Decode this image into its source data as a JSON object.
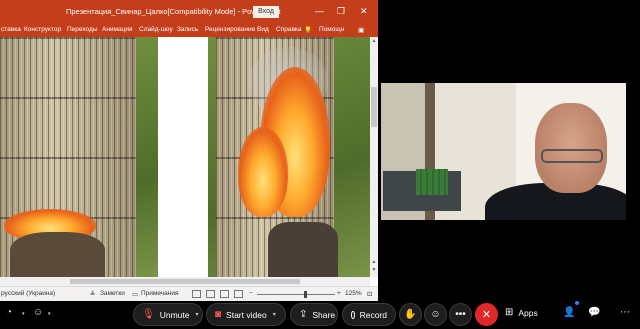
{
  "ppt": {
    "title": "Презентация_Свинар_Цалко[Compatibility Mode]  -  PowerPoint",
    "signin_label": "Вход",
    "win_minimize": "—",
    "win_restore": "❐",
    "win_close": "✕",
    "ribbon_tabs": [
      "ставка",
      "Конструктор",
      "Переходы",
      "Анимация",
      "Слайд-шоу",
      "Запись",
      "Рецензирование",
      "Вид",
      "Справка",
      "Помощн"
    ],
    "status": {
      "language": "русский (Украина)",
      "notes_label": "Заметки",
      "comments_label": "Примечания",
      "zoom_minus": "−",
      "zoom_plus": "+",
      "zoom_percent": "125%",
      "zoom_level": 0.62
    }
  },
  "participant": {
    "name": ""
  },
  "toolbar": {
    "unmute_label": "Unmute",
    "start_video_label": "Start video",
    "share_label": "Share",
    "record_label": "Record",
    "apps_label": "Apps",
    "leave_symbol": "✕",
    "more_symbol": "•••"
  },
  "colors": {
    "ppt_accent": "#c43e1c",
    "leave_red": "#e02828",
    "mute_red": "#ff5a5a"
  }
}
